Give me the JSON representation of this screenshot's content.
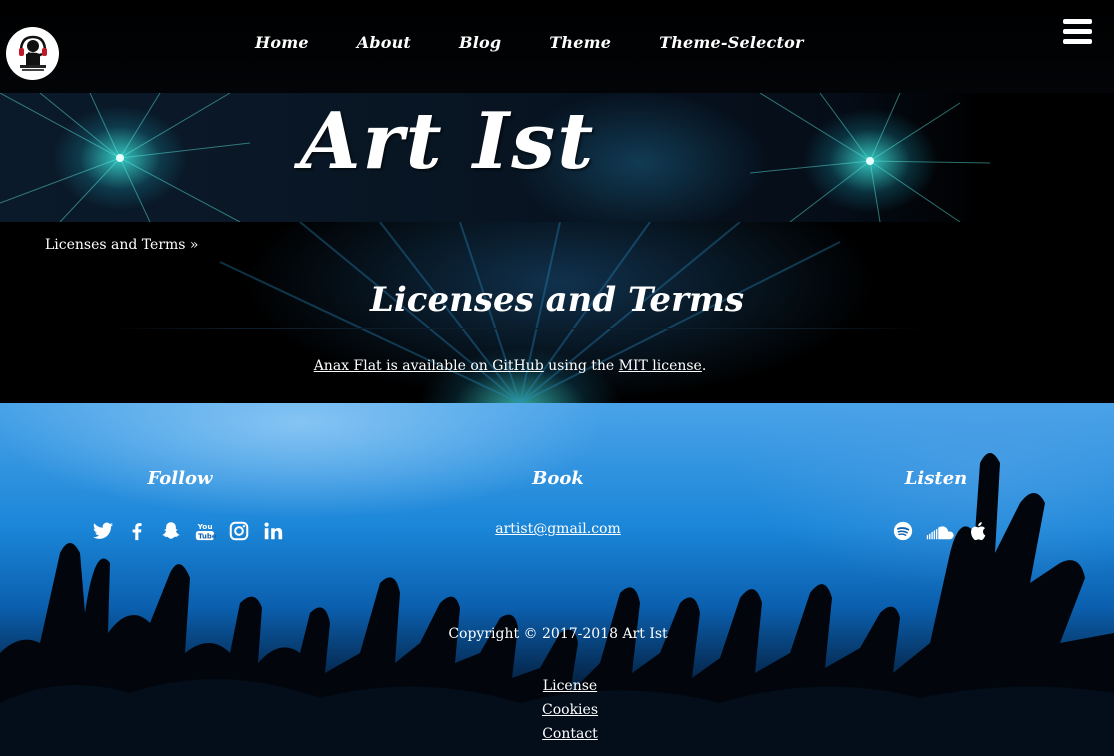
{
  "nav": {
    "items": [
      "Home",
      "About",
      "Blog",
      "Theme",
      "Theme-Selector"
    ]
  },
  "header": {
    "site_title": "Art Ist"
  },
  "main": {
    "breadcrumb": "Licenses and Terms »",
    "title": "Licenses and Terms",
    "license": {
      "link1": "Anax Flat is available on GitHub",
      "middle": " using the ",
      "link2": "MIT license",
      "end": "."
    }
  },
  "footer": {
    "follow_heading": "Follow",
    "book_heading": "Book",
    "listen_heading": "Listen",
    "follow_icons": [
      "twitter-icon",
      "facebook-icon",
      "snapchat-icon",
      "youtube-icon",
      "instagram-icon",
      "linkedin-icon"
    ],
    "listen_icons": [
      "spotify-icon",
      "soundcloud-icon",
      "apple-icon"
    ],
    "email": "artist@gmail.com",
    "copyright": "Copyright © 2017-2018 Art Ist",
    "links": [
      "License",
      "Cookies",
      "Contact"
    ]
  },
  "colors": {
    "text": "#ffffff",
    "nav_background": "#000000",
    "footer_blue": "#1b86d8",
    "accent_cyan": "#3ce6dc"
  }
}
